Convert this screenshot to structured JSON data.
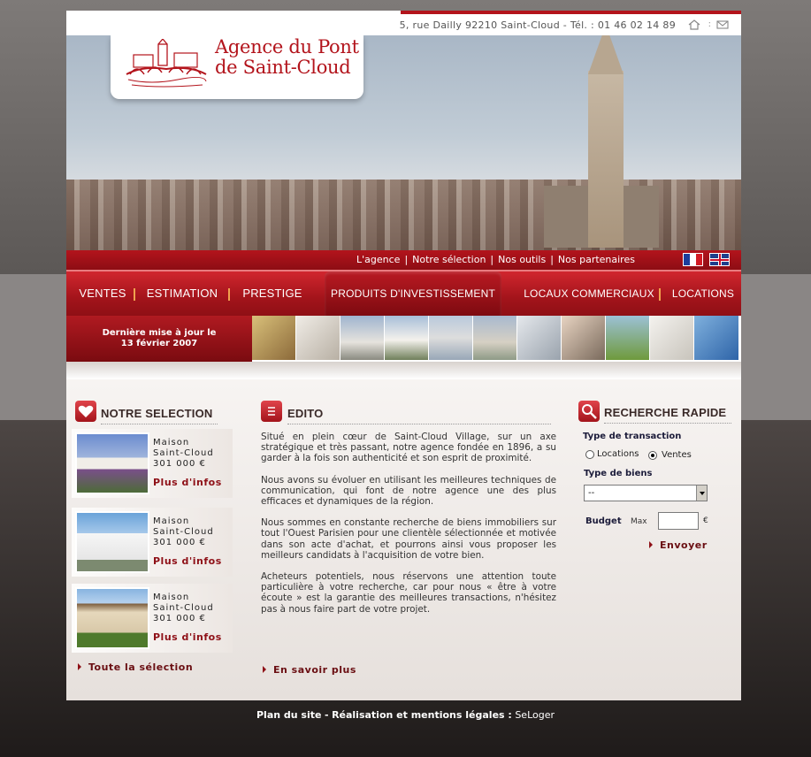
{
  "header": {
    "address": "5, rue Dailly 92210 Saint-Cloud - Tél. : 01 46 02 14 89",
    "separator": ":"
  },
  "logo": {
    "line1": "Agence du Pont",
    "line2": "de Saint-Cloud"
  },
  "top_links": [
    "L'agence",
    "Notre sélection",
    "Nos outils",
    "Nos partenaires"
  ],
  "top_link_separator": "|",
  "flags": [
    "fr",
    "uk"
  ],
  "nav": {
    "items": [
      "VENTES",
      "ESTIMATION",
      "PRESTIGE",
      "PRODUITS D'INVESTISSEMENT",
      "LOCAUX COMMERCIAUX",
      "LOCATIONS"
    ],
    "active_index": 3
  },
  "update": {
    "line1": "Dernière mise à jour le",
    "line2": "13 février 2007"
  },
  "selection": {
    "title": "NOTRE SELECTION",
    "items": [
      {
        "type": "Maison",
        "city": "Saint-Cloud",
        "price": "301 000 €",
        "more": "Plus d'infos"
      },
      {
        "type": "Maison",
        "city": "Saint-Cloud",
        "price": "301 000 €",
        "more": "Plus d'infos"
      },
      {
        "type": "Maison",
        "city": "Saint-Cloud",
        "price": "301 000 €",
        "more": "Plus d'infos"
      }
    ],
    "all_link": "Toute la sélection"
  },
  "edito": {
    "title": "EDITO",
    "paragraphs": [
      "Situé en plein cœur de Saint-Cloud Village, sur un axe stratégique et très passant, notre agence fondée en 1896, a su garder à la fois son authenticité et son esprit de proximité.",
      "Nous avons su évoluer en utilisant les meilleures techniques de communication, qui font de notre agence une des plus efficaces et dynamiques de la région.",
      "Nous sommes en constante recherche de biens immobiliers sur tout l'Ouest Parisien pour une clientèle sélectionnée et motivée dans son acte d'achat, et pourrons ainsi vous proposer les meilleurs candidats à l'acquisition de votre bien.",
      "Acheteurs potentiels, nous réservons une attention toute particulière à votre recherche, car pour nous « être à votre écoute » est la garantie des meilleures transactions, n'hésitez pas à nous faire part de votre projet."
    ],
    "more_link": "En savoir plus"
  },
  "search": {
    "title": "RECHERCHE RAPIDE",
    "transaction_label": "Type de transaction",
    "options": [
      "Locations",
      "Ventes"
    ],
    "selected_option": "Ventes",
    "type_label": "Type de biens",
    "type_value": "--",
    "budget_label": "Budget",
    "max_label": "Max",
    "budget_value": "",
    "currency": "€",
    "submit": "Envoyer"
  },
  "footer": {
    "sitemap": "Plan du site",
    "dash": "-",
    "credits": "Réalisation et mentions légales :",
    "seloger": "SeLoger"
  },
  "colors": {
    "brand_red": "#b3141c",
    "link_dark_red": "#8e1017"
  }
}
